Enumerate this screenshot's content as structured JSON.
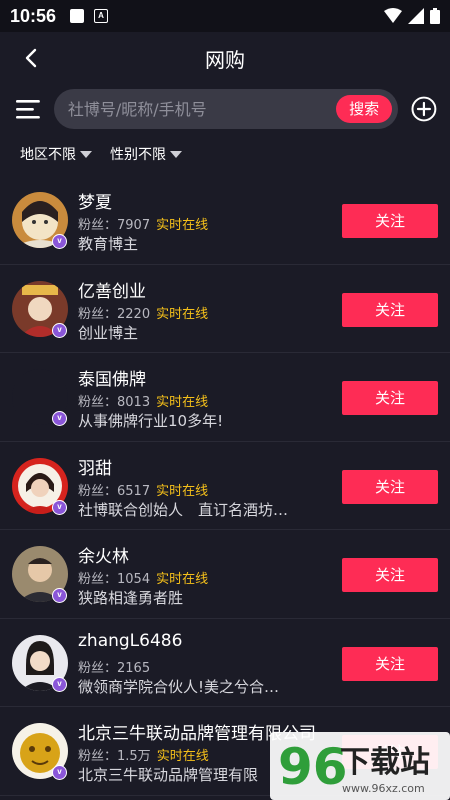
{
  "status": {
    "time": "10:56"
  },
  "header": {
    "title": "网购"
  },
  "search": {
    "placeholder": "社博号/昵称/手机号",
    "button": "搜索"
  },
  "filters": [
    {
      "label": "地区不限"
    },
    {
      "label": "性别不限"
    }
  ],
  "live_label": "实时在线",
  "follow_label": "关注",
  "users": [
    {
      "name": "梦夏",
      "fans": "粉丝：7907",
      "live": true,
      "bio": "教育博主",
      "avatar_color": "#c98b3d"
    },
    {
      "name": "亿善创业",
      "fans": "粉丝：2220",
      "live": true,
      "bio": "创业博主",
      "avatar_color": "#b12d2a"
    },
    {
      "name": "泰国佛牌",
      "fans": "粉丝：8013",
      "live": true,
      "bio": "从事佛牌行业10多年!",
      "avatar_color": "#1b1b26"
    },
    {
      "name": "羽甜",
      "fans": "粉丝：6517",
      "live": true,
      "bio": "社博联合创始人　直订名酒坊…",
      "avatar_color": "#d6241e"
    },
    {
      "name": "余火林",
      "fans": "粉丝：1054",
      "live": true,
      "bio": "狭路相逢勇者胜",
      "avatar_color": "#9a8a6e"
    },
    {
      "name": "zhangL6486",
      "fans": "粉丝：2165",
      "live": false,
      "bio": "微领商学院合伙人!美之兮合…",
      "avatar_color": "#e9e9ee"
    },
    {
      "name": "北京三牛联动品牌管理有限公司",
      "fans": "粉丝：1.5万",
      "live": true,
      "bio": "北京三牛联动品牌管理有限",
      "avatar_color": "#d8a318"
    }
  ],
  "watermark": {
    "text": "下载站",
    "number": "96",
    "url": "www.96xz.com"
  },
  "colors": {
    "accent": "#fe2c55",
    "live": "#f5c01a",
    "background": "#1b1b26",
    "badge": "#8a56d8"
  }
}
